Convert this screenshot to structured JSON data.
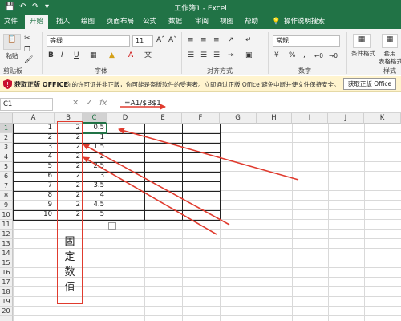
{
  "titlebar": {
    "title": "工作簿1  -  Excel",
    "save_icon": "save-icon",
    "undo_icon": "undo-icon",
    "redo_icon": "redo-icon"
  },
  "ribbon_tabs": [
    "文件",
    "开始",
    "插入",
    "绘图",
    "页面布局",
    "公式",
    "数据",
    "审阅",
    "视图",
    "帮助",
    "操作说明搜索"
  ],
  "ribbon": {
    "paste_label": "粘贴",
    "clipboard_label": "剪贴板",
    "font_name": "等线",
    "font_size": "11",
    "font_group_label": "字体",
    "align_group_label": "对齐方式",
    "number_format": "常规",
    "number_group_label": "数字",
    "cond_format_label": "条件格式",
    "table_format_label": "套用\n表格格式",
    "styles_label": "样式",
    "percent_label": "%",
    "bold": "B",
    "italic": "I",
    "underline": "U"
  },
  "notice": {
    "title": "获取正版 OFFICE",
    "message": "你的许可证并非正版，你可能是盗版软件的受害者。立即通过正版 Office 避免中断并使文件保持安全。",
    "button": "获取正版 Office"
  },
  "formula_bar": {
    "name_box": "C1",
    "cancel": "✕",
    "confirm": "✓",
    "fx": "fx",
    "formula": "=A1/$B$1"
  },
  "columns": [
    "A",
    "B",
    "C",
    "D",
    "E",
    "F",
    "G",
    "H",
    "I",
    "J",
    "K"
  ],
  "rows": [
    "1",
    "2",
    "3",
    "4",
    "5",
    "6",
    "7",
    "8",
    "9",
    "10",
    "11",
    "12",
    "13",
    "14",
    "15",
    "16",
    "17",
    "18",
    "19",
    "20"
  ],
  "sheet": {
    "col_a": [
      "1",
      "2",
      "3",
      "4",
      "5",
      "6",
      "7",
      "8",
      "9",
      "10"
    ],
    "col_b": [
      "2",
      "2",
      "2",
      "2",
      "2",
      "2",
      "2",
      "2",
      "2",
      "2"
    ],
    "col_c": [
      "0.5",
      "1",
      "1.5",
      "2",
      "2.5",
      "3",
      "3.5",
      "4",
      "4.5",
      "5"
    ]
  },
  "annotation": {
    "text": [
      "固",
      "定",
      "数",
      "值"
    ]
  },
  "colors": {
    "excel_green": "#217346",
    "annotation_red": "#e03b2e"
  }
}
